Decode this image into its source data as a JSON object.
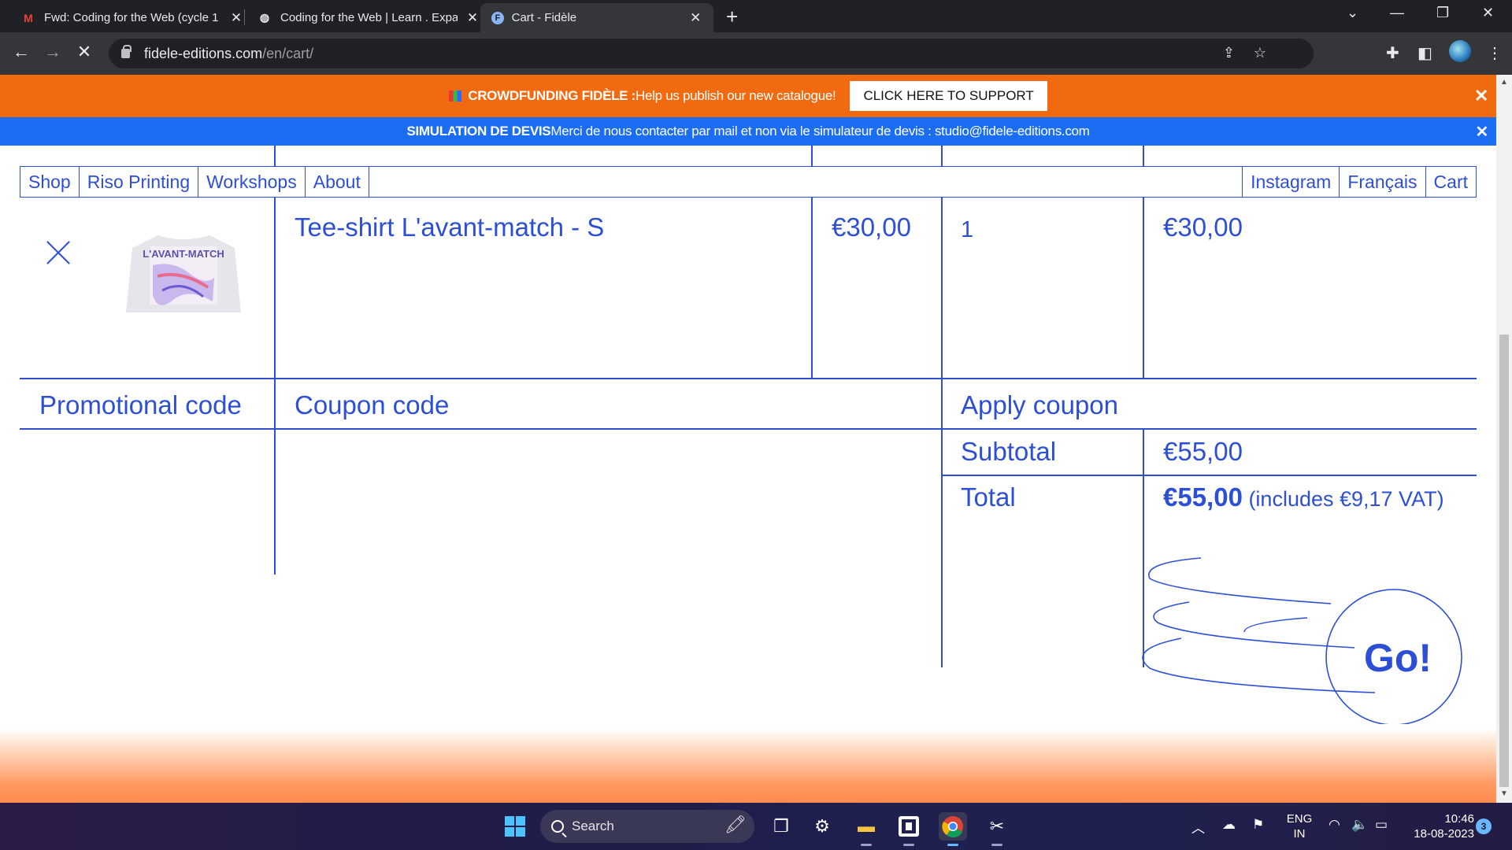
{
  "browser": {
    "tabs": [
      {
        "title": "Fwd: Coding for the Web (cycle 1",
        "favicon": "gmail-icon"
      },
      {
        "title": "Coding for the Web | Learn . Expa",
        "favicon": "globe-icon"
      },
      {
        "title": "Cart - Fidèle",
        "favicon": "fidele-icon",
        "active": true
      }
    ],
    "url_domain": "fidele-editions.com",
    "url_path": "/en/cart/"
  },
  "banners": {
    "crowdfunding_bold": "CROWDFUNDING FIDÈLE :",
    "crowdfunding_text": " Help us publish our new catalogue!",
    "support_button": "CLICK HERE TO SUPPORT",
    "close": "✕",
    "simulation_bold": "SIMULATION DE DEVIS",
    "simulation_text": " Merci de nous contacter par mail et non via le simulateur de devis : studio@fidele-editions.com"
  },
  "nav": {
    "left": [
      "Shop",
      "Riso Printing",
      "Workshops",
      "About"
    ],
    "right": [
      "Instagram",
      "Français",
      "Cart"
    ]
  },
  "cart": {
    "item": {
      "name": "Tee-shirt L'avant-match - S",
      "price": "€30,00",
      "quantity": "1",
      "subtotal": "€30,00",
      "thumbnail_text": "L'AVANT-MATCH"
    },
    "promo_label": "Promotional code",
    "coupon_placeholder": "Coupon code",
    "apply_coupon": "Apply coupon",
    "subtotal_label": "Subtotal",
    "subtotal_value": "€55,00",
    "total_label": "Total",
    "total_value": "€55,00",
    "total_vat": " (includes €9,17 VAT)"
  },
  "go_button": "Go!",
  "taskbar": {
    "search": "Search",
    "lang_top": "ENG",
    "lang_bottom": "IN",
    "time": "10:46",
    "date": "18-08-2023",
    "notifications": "3"
  },
  "colors": {
    "brand_blue": "#2d4fd6",
    "banner_orange": "#f26a0f",
    "banner_blue": "#1b6ef3"
  }
}
